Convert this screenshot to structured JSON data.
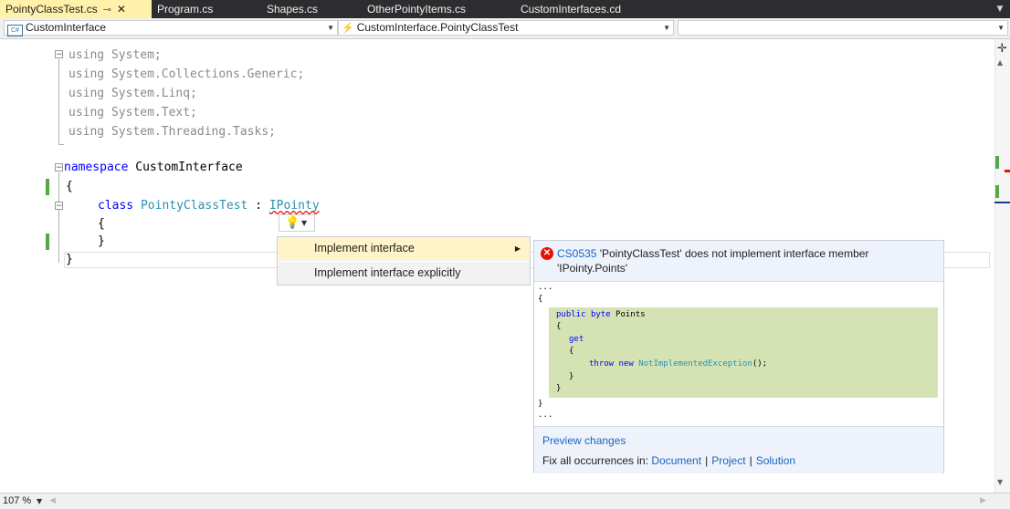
{
  "tabs": [
    {
      "label": "PointyClassTest.cs",
      "pin": "⊸",
      "close": "✕",
      "active": true
    },
    {
      "label": "Program.cs"
    },
    {
      "label": "Shapes.cs"
    },
    {
      "label": "OtherPointyItems.cs"
    },
    {
      "label": "CustomInterfaces.cd"
    }
  ],
  "navbar": {
    "project": "CustomInterface",
    "member": "CustomInterface.PointyClassTest",
    "third": ""
  },
  "code": {
    "using1": "using System;",
    "using2": "using System.Collections.Generic;",
    "using3": "using System.Linq;",
    "using4": "using System.Text;",
    "using5": "using System.Threading.Tasks;",
    "ns_kw": "namespace",
    "ns_name": " CustomInterface",
    "brace_open": "{",
    "class_kw": "class",
    "class_name": "PointyClassTest",
    "colon": " : ",
    "iface": "IPointy",
    "brace_inner_open": "{",
    "brace_inner_close": "}",
    "brace_close": "}"
  },
  "quick_actions": {
    "items": [
      {
        "label": "Implement interface",
        "selected": true,
        "has_submenu": true
      },
      {
        "label": "Implement interface explicitly",
        "selected": false,
        "has_submenu": false
      }
    ]
  },
  "preview": {
    "error_code": "CS0535",
    "error_message": " 'PointyClassTest' does not implement interface member 'IPointy.Points'",
    "lines": {
      "l0": "...",
      "l1": "{",
      "l2_kw1": "public",
      "l2_kw2": "byte",
      "l2_rest": " Points",
      "l3": "{",
      "l4": "get",
      "l5": "{",
      "l6_kw1": "throw",
      "l6_kw2": "new",
      "l6_type": "NotImplementedException",
      "l6_rest": "();",
      "l7": "}",
      "l8": "}",
      "l9": "}",
      "l10": "..."
    },
    "preview_changes": "Preview changes",
    "fix_all_label": "Fix all occurrences in: ",
    "fix_scopes": [
      "Document",
      "Project",
      "Solution"
    ],
    "separator": "|"
  },
  "bottom": {
    "zoom": "107 %"
  },
  "colors": {
    "tab_active_bg": "#fff1a9",
    "change_marker": "#57a64a",
    "error": "#e51400",
    "preview_highlight": "#d5e3b4",
    "link": "#1b64c2"
  },
  "icons": {
    "lightbulb": "lightbulb-icon",
    "error": "error-icon",
    "split": "split-icon"
  }
}
